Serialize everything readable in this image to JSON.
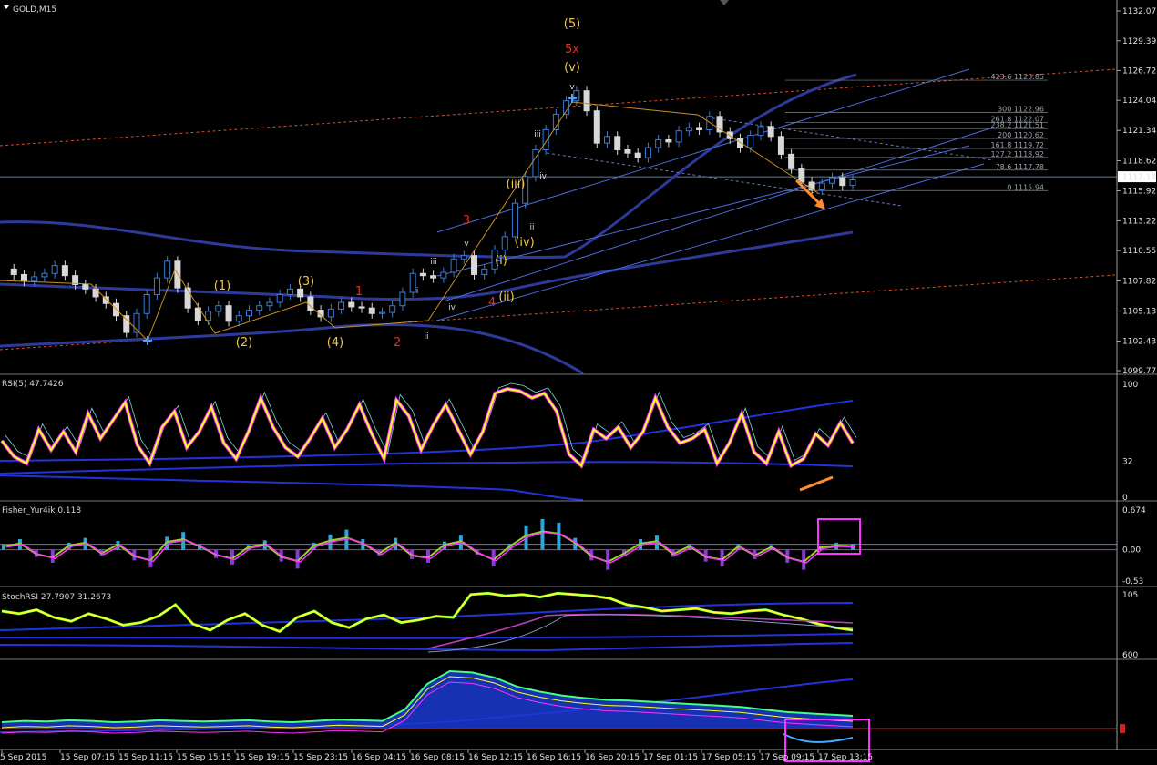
{
  "chart_title": "GOLD,M15",
  "colors": {
    "background": "#000000",
    "bull": "#3a7bd5",
    "bear": "#d8d8d8",
    "wave_yellow": "#f2c744",
    "wave_red": "#e0301e",
    "wave_magenta": "#c040c0",
    "wave_orange": "#e8821e",
    "channel": "#3355cc",
    "fib": "#7f8790",
    "rsi_main": "#ffff22",
    "rsi_shadow": "#ff33ff",
    "box": "#ff33ff",
    "arrow": "#ff8c32"
  },
  "chart_data": [
    {
      "type": "candlestick",
      "panel": "main",
      "title": "GOLD,M15",
      "ylim": [
        1099.77,
        1132.07
      ],
      "y_ticks": [
        "1132.07",
        "1129.39",
        "1126.72",
        "1124.04",
        "1121.34",
        "1118.62",
        "1115.92",
        "1113.22",
        "1110.55",
        "1107.82",
        "1105.13",
        "1102.43",
        "1099.77"
      ],
      "current_price": "1117.18",
      "x_ticks": [
        "5 Sep 2015",
        "15 Sep 07:15",
        "15 Sep 11:15",
        "15 Sep 15:15",
        "15 Sep 19:15",
        "15 Sep 23:15",
        "16 Sep 04:15",
        "16 Sep 08:15",
        "16 Sep 12:15",
        "16 Sep 16:15",
        "16 Sep 20:15",
        "17 Sep 01:15",
        "17 Sep 05:15",
        "17 Sep 09:15",
        "17 Sep 13:15"
      ],
      "close_path": [
        1108.9,
        1108.4,
        1107.8,
        1108.2,
        1108.5,
        1109.2,
        1108.3,
        1107.5,
        1107.1,
        1106.4,
        1105.8,
        1104.7,
        1103.2,
        1104.9,
        1106.6,
        1108.1,
        1109.6,
        1107.2,
        1105.4,
        1104.3,
        1105.1,
        1105.6,
        1104.2,
        1104.7,
        1105.2,
        1105.6,
        1105.9,
        1106.6,
        1107.1,
        1106.4,
        1105.2,
        1104.6,
        1105.3,
        1105.9,
        1105.5,
        1105.4,
        1104.9,
        1105.0,
        1105.6,
        1106.8,
        1108.5,
        1108.3,
        1108.1,
        1108.6,
        1109.8,
        1110.1,
        1108.4,
        1108.9,
        1110.6,
        1111.8,
        1114.8,
        1117.2,
        1119.6,
        1121.4,
        1122.8,
        1124.0,
        1124.9,
        1123.1,
        1120.2,
        1120.8,
        1119.6,
        1119.3,
        1118.9,
        1119.8,
        1120.5,
        1120.3,
        1121.3,
        1121.6,
        1121.4,
        1122.6,
        1121.2,
        1120.6,
        1119.8,
        1120.9,
        1121.7,
        1120.8,
        1119.2,
        1117.9,
        1116.7,
        1116.0,
        1116.6,
        1117.1,
        1116.4,
        1116.9
      ],
      "annotations": {
        "yellow": [
          "(1)",
          "(2)",
          "(3)",
          "(4)",
          "(5)",
          "(i)",
          "(ii)",
          "(iii)",
          "(iv)",
          "(v)"
        ],
        "red": [
          "1",
          "2",
          "3",
          "4",
          "5x"
        ],
        "magenta": [
          "i",
          "ii",
          "iii",
          "iv",
          "v",
          "ii",
          "iii",
          "iv",
          "v"
        ]
      },
      "fib_levels": [
        {
          "ratio": "423.6",
          "price": "1125.85"
        },
        {
          "ratio": "300",
          "price": "1122.96"
        },
        {
          "ratio": "261.8",
          "price": "1122.07"
        },
        {
          "ratio": "238.2",
          "price": "1121.51"
        },
        {
          "ratio": "200",
          "price": "1120.62"
        },
        {
          "ratio": "161.8",
          "price": "1119.72"
        },
        {
          "ratio": "127.2",
          "price": "1118.92"
        },
        {
          "ratio": "78.6",
          "price": "1117.78"
        },
        {
          "ratio": "0",
          "price": "1115.94"
        }
      ]
    },
    {
      "type": "line",
      "panel": "rsi",
      "title": "RSI(5) 47.7426",
      "ylim": [
        0,
        100
      ],
      "y_ticks": [
        "100",
        "32",
        "0"
      ],
      "values": [
        50,
        36,
        30,
        60,
        42,
        58,
        40,
        74,
        52,
        68,
        84,
        46,
        30,
        62,
        76,
        44,
        58,
        80,
        48,
        34,
        58,
        88,
        62,
        44,
        36,
        52,
        70,
        44,
        60,
        82,
        56,
        34,
        86,
        72,
        42,
        64,
        82,
        60,
        38,
        58,
        92,
        96,
        94,
        88,
        92,
        76,
        38,
        28,
        60,
        52,
        62,
        44,
        58,
        88,
        62,
        48,
        52,
        60,
        30,
        48,
        74,
        40,
        30,
        58,
        28,
        34,
        56,
        46,
        66,
        48
      ]
    },
    {
      "type": "bar",
      "panel": "fisher",
      "title": "Fisher_Yur4ik 0.118",
      "ylim": [
        -0.53,
        0.674
      ],
      "y_ticks": [
        "0.674",
        "0.00",
        "-0.53"
      ],
      "values": [
        0.1,
        0.18,
        -0.12,
        -0.22,
        0.12,
        0.2,
        -0.1,
        0.15,
        -0.18,
        -0.3,
        0.22,
        0.3,
        0.1,
        -0.14,
        -0.25,
        0.08,
        0.16,
        -0.2,
        -0.32,
        0.12,
        0.26,
        0.34,
        0.18,
        -0.1,
        0.2,
        -0.16,
        -0.22,
        0.14,
        0.24,
        -0.08,
        -0.28,
        0.1,
        0.4,
        0.52,
        0.46,
        0.2,
        -0.18,
        -0.34,
        -0.1,
        0.18,
        0.24,
        -0.12,
        0.1,
        -0.2,
        -0.28,
        0.1,
        -0.16,
        0.08,
        -0.22,
        -0.34,
        0.06,
        0.12,
        0.1
      ]
    },
    {
      "type": "line",
      "panel": "stoch",
      "title": "StochRSI 27.7907 31.2673",
      "y_ticks": [
        "105",
        "600"
      ],
      "values": [
        70,
        66,
        72,
        60,
        54,
        66,
        58,
        48,
        52,
        62,
        80,
        50,
        40,
        56,
        66,
        48,
        38,
        60,
        70,
        52,
        44,
        58,
        64,
        52,
        56,
        62,
        60,
        96,
        98,
        94,
        96,
        92,
        98,
        96,
        94,
        90,
        80,
        76,
        70,
        72,
        74,
        68,
        66,
        70,
        72,
        64,
        58,
        50,
        44,
        40
      ]
    },
    {
      "type": "area",
      "panel": "volatility",
      "title": "",
      "values": [
        10,
        12,
        11,
        13,
        12,
        10,
        11,
        13,
        12,
        11,
        12,
        13,
        11,
        10,
        12,
        14,
        13,
        12,
        30,
        70,
        90,
        88,
        80,
        66,
        58,
        52,
        48,
        45,
        44,
        42,
        40,
        38,
        36,
        34,
        30,
        26,
        24,
        22,
        20
      ]
    }
  ]
}
